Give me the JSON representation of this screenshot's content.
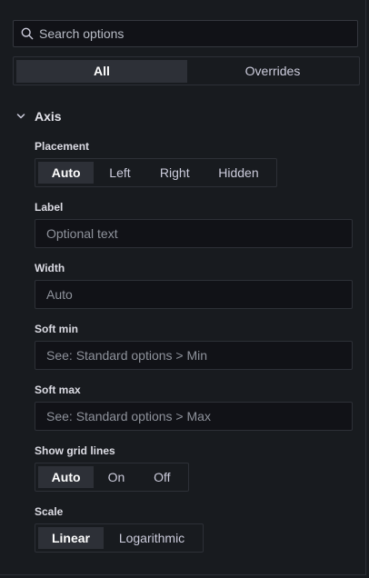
{
  "search": {
    "placeholder": "Search options"
  },
  "tabs": {
    "all": "All",
    "overrides": "Overrides",
    "active": "All"
  },
  "section": {
    "title": "Axis"
  },
  "placement": {
    "label": "Placement",
    "options": [
      "Auto",
      "Left",
      "Right",
      "Hidden"
    ],
    "selected": "Auto"
  },
  "label_field": {
    "label": "Label",
    "placeholder": "Optional text"
  },
  "width_field": {
    "label": "Width",
    "placeholder": "Auto"
  },
  "soft_min": {
    "label": "Soft min",
    "placeholder": "See: Standard options > Min"
  },
  "soft_max": {
    "label": "Soft max",
    "placeholder": "See: Standard options > Max"
  },
  "grid_lines": {
    "label": "Show grid lines",
    "options": [
      "Auto",
      "On",
      "Off"
    ],
    "selected": "Auto"
  },
  "scale": {
    "label": "Scale",
    "options": [
      "Linear",
      "Logarithmic"
    ],
    "selected": "Linear"
  },
  "colors": {
    "background": "#181b1f",
    "input_bg": "#111217",
    "border": "#2d3037",
    "active_bg": "#2d3037"
  },
  "icons": {
    "search": "search-icon",
    "section_toggle": "chevron-down-icon"
  }
}
